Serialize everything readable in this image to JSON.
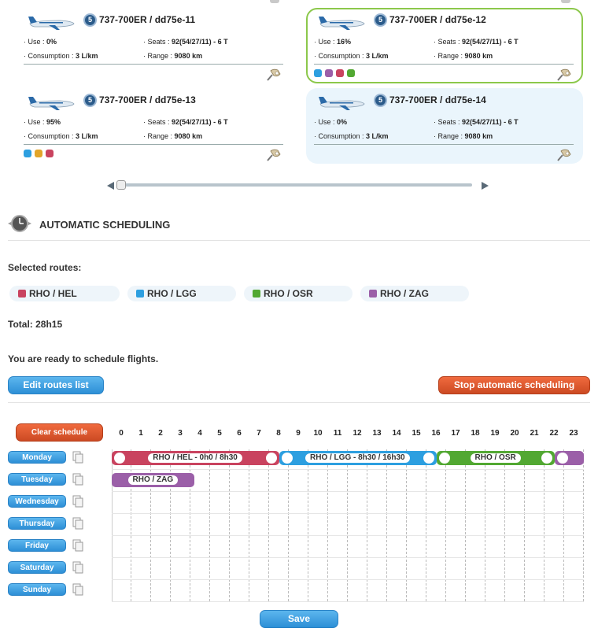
{
  "aircraft": [
    {
      "title": "737-700ER / dd75e-11",
      "badge": "5",
      "use_label": "Use :",
      "use": "0%",
      "seats_label": "Seats :",
      "seats": "92(54/27/11) - 6 T",
      "consumption_label": "Consumption :",
      "consumption": "3 L/km",
      "range_label": "Range :",
      "range": "9080 km",
      "route_colors": []
    },
    {
      "title": "737-700ER / dd75e-12",
      "badge": "5",
      "use_label": "Use :",
      "use": "16%",
      "seats_label": "Seats :",
      "seats": "92(54/27/11) - 6 T",
      "consumption_label": "Consumption :",
      "consumption": "3 L/km",
      "range_label": "Range :",
      "range": "9080 km",
      "route_colors": [
        "#2d9fe0",
        "#9b5fa8",
        "#c9435f",
        "#52a832"
      ]
    },
    {
      "title": "737-700ER / dd75e-13",
      "badge": "5",
      "use_label": "Use :",
      "use": "95%",
      "seats_label": "Seats :",
      "seats": "92(54/27/11) - 6 T",
      "consumption_label": "Consumption :",
      "consumption": "3 L/km",
      "range_label": "Range :",
      "range": "9080 km",
      "route_colors": [
        "#2d9fe0",
        "#e2a52a",
        "#c9435f"
      ]
    },
    {
      "title": "737-700ER / dd75e-14",
      "badge": "5",
      "use_label": "Use :",
      "use": "0%",
      "seats_label": "Seats :",
      "seats": "92(54/27/11) - 6 T",
      "consumption_label": "Consumption :",
      "consumption": "3 L/km",
      "range_label": "Range :",
      "range": "9080 km",
      "route_colors": []
    }
  ],
  "section": {
    "title": "AUTOMATIC SCHEDULING"
  },
  "selected_routes_label": "Selected routes:",
  "routes": [
    {
      "label": "RHO / HEL",
      "color": "#c9435f"
    },
    {
      "label": "RHO / LGG",
      "color": "#2d9fe0"
    },
    {
      "label": "RHO / OSR",
      "color": "#52a832"
    },
    {
      "label": "RHO / ZAG",
      "color": "#9b5fa8"
    }
  ],
  "total": "Total: 28h15",
  "ready_msg": "You are ready to schedule flights.",
  "buttons": {
    "edit_routes": "Edit routes list",
    "stop_auto": "Stop automatic scheduling",
    "clear_schedule": "Clear schedule",
    "save": "Save"
  },
  "hours": [
    "0",
    "1",
    "2",
    "3",
    "4",
    "5",
    "6",
    "7",
    "8",
    "9",
    "10",
    "11",
    "12",
    "13",
    "14",
    "15",
    "16",
    "17",
    "18",
    "19",
    "20",
    "21",
    "22",
    "23"
  ],
  "days": [
    "Monday",
    "Tuesday",
    "Wednesday",
    "Thursday",
    "Friday",
    "Saturday",
    "Sunday"
  ],
  "schedule": [
    {
      "day": "Monday",
      "start": 0,
      "end": 8.5,
      "color": "#c9435f",
      "label": "RHO / HEL - 0h0 / 8h30"
    },
    {
      "day": "Monday",
      "start": 8.5,
      "end": 16.5,
      "color": "#2d9fe0",
      "label": "RHO / LGG - 8h30 / 16h30"
    },
    {
      "day": "Monday",
      "start": 16.5,
      "end": 22.5,
      "color": "#52a832",
      "label": "RHO / OSR"
    },
    {
      "day": "Monday",
      "start": 22.5,
      "end": 24,
      "color": "#9b5fa8",
      "label": ""
    },
    {
      "day": "Tuesday",
      "start": 0,
      "end": 4.2,
      "color": "#9b5fa8",
      "label": "RHO / ZAG"
    }
  ]
}
